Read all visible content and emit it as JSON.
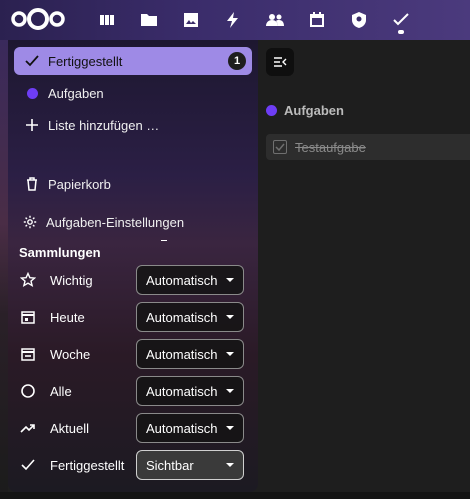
{
  "colors": {
    "accent": "#9e8ae6",
    "list_dot": "#6e3df5",
    "header": "#3a2c6a"
  },
  "header": {
    "logo": "nextcloud-logo",
    "apps": [
      {
        "name": "dashboard-icon"
      },
      {
        "name": "files-icon"
      },
      {
        "name": "photos-icon"
      },
      {
        "name": "activity-icon"
      },
      {
        "name": "contacts-icon"
      },
      {
        "name": "calendar-icon"
      },
      {
        "name": "deck-icon"
      },
      {
        "name": "tasks-icon",
        "active": true
      }
    ]
  },
  "sidebar": {
    "items": [
      {
        "label": "Fertiggestellt",
        "count": "1",
        "icon": "check-icon",
        "active": true
      },
      {
        "label": "Aufgaben",
        "icon": "list-color-dot"
      },
      {
        "label": "Liste hinzufügen …",
        "icon": "plus-icon"
      },
      {
        "label": "Papierkorb",
        "icon": "trash-icon"
      },
      {
        "label": "Aufgaben-Einstellungen",
        "icon": "gear-icon"
      }
    ],
    "collections_title": "Sammlungen",
    "collections": [
      {
        "label": "Wichtig",
        "icon": "star-icon",
        "value": "Automatisch"
      },
      {
        "label": "Heute",
        "icon": "calendar-today-icon",
        "value": "Automatisch"
      },
      {
        "label": "Woche",
        "icon": "calendar-week-icon",
        "value": "Automatisch"
      },
      {
        "label": "Alle",
        "icon": "circle-icon",
        "value": "Automatisch"
      },
      {
        "label": "Aktuell",
        "icon": "trending-up-icon",
        "value": "Automatisch"
      },
      {
        "label": "Fertiggestellt",
        "icon": "check-icon",
        "value": "Sichtbar"
      }
    ]
  },
  "main": {
    "list_title": "Aufgaben",
    "tasks": [
      {
        "title": "Testaufgabe",
        "done": true
      }
    ]
  }
}
